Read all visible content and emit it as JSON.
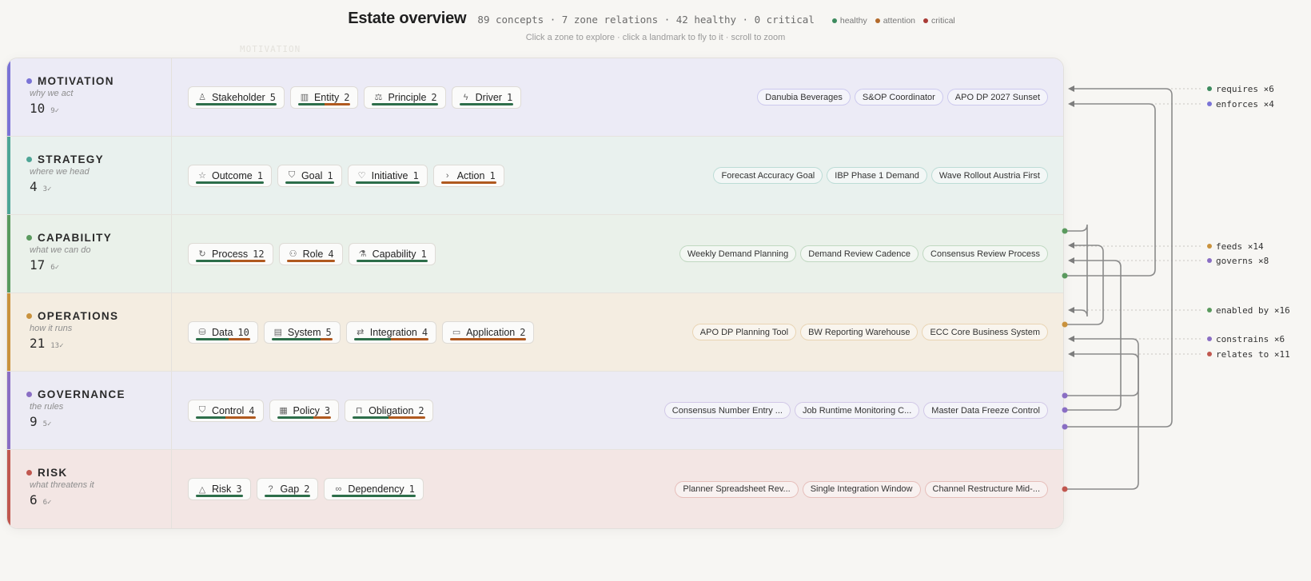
{
  "header": {
    "title": "Estate overview",
    "stats": "89 concepts · 7 zone relations · 42 healthy · 0 critical",
    "subtitle": "Click a zone to explore · click a landmark to fly to it · scroll to zoom",
    "legend": [
      {
        "label": "healthy",
        "color": "#3d8b5e"
      },
      {
        "label": "attention",
        "color": "#b36a2b"
      },
      {
        "label": "critical",
        "color": "#a93a35"
      }
    ]
  },
  "ghost_label": "MOTIVATION",
  "zones": [
    {
      "name": "MOTIVATION",
      "subtitle": "why we act",
      "count": "10",
      "healthy": "9✓",
      "accent": "#7a73d6",
      "bg": "#ecebf6",
      "chips": [
        {
          "icon": "person-icon",
          "glyph": "♙",
          "label": "Stakeholder",
          "count": "5",
          "health": [
            1,
            0,
            0
          ]
        },
        {
          "icon": "building-icon",
          "glyph": "▥",
          "label": "Entity",
          "count": "2",
          "health": [
            0.5,
            0.5,
            0
          ]
        },
        {
          "icon": "scale-icon",
          "glyph": "⚖",
          "label": "Principle",
          "count": "2",
          "health": [
            1,
            0,
            0
          ]
        },
        {
          "icon": "bolt-icon",
          "glyph": "ϟ",
          "label": "Driver",
          "count": "1",
          "health": [
            1,
            0,
            0
          ]
        }
      ],
      "landmarks": [
        {
          "label": "Danubia Beverages"
        },
        {
          "label": "S&OP Coordinator"
        },
        {
          "label": "APO DP 2027 Sunset"
        }
      ]
    },
    {
      "name": "STRATEGY",
      "subtitle": "where we head",
      "count": "4",
      "healthy": "3✓",
      "accent": "#4ea596",
      "bg": "#e9f1ee",
      "chips": [
        {
          "icon": "star-icon",
          "glyph": "☆",
          "label": "Outcome",
          "count": "1",
          "health": [
            1,
            0,
            0
          ]
        },
        {
          "icon": "shield-icon",
          "glyph": "⛉",
          "label": "Goal",
          "count": "1",
          "health": [
            1,
            0,
            0
          ]
        },
        {
          "icon": "heart-icon",
          "glyph": "♡",
          "label": "Initiative",
          "count": "1",
          "health": [
            1,
            0,
            0
          ]
        },
        {
          "icon": "chevron-right-icon",
          "glyph": "›",
          "label": "Action",
          "count": "1",
          "health": [
            0,
            1,
            0
          ]
        }
      ],
      "landmarks": [
        {
          "label": "Forecast Accuracy Goal"
        },
        {
          "label": "IBP Phase 1 Demand"
        },
        {
          "label": "Wave Rollout Austria First"
        }
      ]
    },
    {
      "name": "CAPABILITY",
      "subtitle": "what we can do",
      "count": "17",
      "healthy": "6✓",
      "accent": "#5a9a5e",
      "bg": "#eaf1ea",
      "chips": [
        {
          "icon": "cycle-icon",
          "glyph": "↻",
          "label": "Process",
          "count": "12",
          "health": [
            0.5,
            0.5,
            0
          ]
        },
        {
          "icon": "people-icon",
          "glyph": "⚇",
          "label": "Role",
          "count": "4",
          "health": [
            0,
            1,
            0
          ]
        },
        {
          "icon": "flask-icon",
          "glyph": "⚗",
          "label": "Capability",
          "count": "1",
          "health": [
            1,
            0,
            0
          ]
        }
      ],
      "landmarks": [
        {
          "label": "Weekly Demand Planning"
        },
        {
          "label": "Demand Review Cadence"
        },
        {
          "label": "Consensus Review Process"
        }
      ]
    },
    {
      "name": "OPERATIONS",
      "subtitle": "how it runs",
      "count": "21",
      "healthy": "13✓",
      "accent": "#c9923d",
      "bg": "#f4ede1",
      "chips": [
        {
          "icon": "database-icon",
          "glyph": "⛁",
          "label": "Data",
          "count": "10",
          "health": [
            0.6,
            0.4,
            0
          ]
        },
        {
          "icon": "server-icon",
          "glyph": "▤",
          "label": "System",
          "count": "5",
          "health": [
            0.8,
            0.2,
            0
          ]
        },
        {
          "icon": "swap-icon",
          "glyph": "⇄",
          "label": "Integration",
          "count": "4",
          "health": [
            0.5,
            0.5,
            0
          ]
        },
        {
          "icon": "monitor-icon",
          "glyph": "▭",
          "label": "Application",
          "count": "2",
          "health": [
            0,
            1,
            0
          ]
        }
      ],
      "landmarks": [
        {
          "label": "APO DP Planning Tool"
        },
        {
          "label": "BW Reporting Warehouse"
        },
        {
          "label": "ECC Core Business System"
        }
      ]
    },
    {
      "name": "GOVERNANCE",
      "subtitle": "the rules",
      "count": "9",
      "healthy": "5✓",
      "accent": "#8a6ec4",
      "bg": "#ecebf4",
      "chips": [
        {
          "icon": "shield-check-icon",
          "glyph": "⛉",
          "label": "Control",
          "count": "4",
          "health": [
            0.5,
            0.5,
            0
          ]
        },
        {
          "icon": "document-icon",
          "glyph": "▦",
          "label": "Policy",
          "count": "3",
          "health": [
            0.67,
            0.33,
            0
          ]
        },
        {
          "icon": "lock-icon",
          "glyph": "⊓",
          "label": "Obligation",
          "count": "2",
          "health": [
            0.5,
            0.5,
            0
          ]
        }
      ],
      "landmarks": [
        {
          "label": "Consensus Number Entry ..."
        },
        {
          "label": "Job Runtime Monitoring C..."
        },
        {
          "label": "Master Data Freeze Control"
        }
      ]
    },
    {
      "name": "RISK",
      "subtitle": "what threatens it",
      "count": "6",
      "healthy": "6✓",
      "accent": "#c0574f",
      "bg": "#f3e6e4",
      "chips": [
        {
          "icon": "warning-icon",
          "glyph": "△",
          "label": "Risk",
          "count": "3",
          "health": [
            1,
            0,
            0
          ]
        },
        {
          "icon": "question-icon",
          "glyph": "?",
          "label": "Gap",
          "count": "2",
          "health": [
            1,
            0,
            0
          ]
        },
        {
          "icon": "link-icon",
          "glyph": "∞",
          "label": "Dependency",
          "count": "1",
          "health": [
            1,
            0,
            0
          ]
        }
      ],
      "landmarks": [
        {
          "label": "Planner Spreadsheet Rev..."
        },
        {
          "label": "Single Integration Window"
        },
        {
          "label": "Channel Restructure Mid-..."
        }
      ]
    }
  ],
  "relations": [
    {
      "label": "requires ×6",
      "color": "#3d8b5e",
      "from": "GOVERNANCE",
      "to": "MOTIVATION"
    },
    {
      "label": "enforces ×4",
      "color": "#7a73d6",
      "from": "CAPABILITY",
      "to": "MOTIVATION"
    },
    {
      "label": "feeds ×14",
      "color": "#c9923d",
      "from": "OPERATIONS",
      "to": "CAPABILITY"
    },
    {
      "label": "governs ×8",
      "color": "#8a6ec4",
      "from": "GOVERNANCE",
      "to": "CAPABILITY"
    },
    {
      "label": "enabled by ×16",
      "color": "#5a9a5e",
      "from": "CAPABILITY",
      "to": "OPERATIONS"
    },
    {
      "label": "constrains ×6",
      "color": "#8a6ec4",
      "from": "GOVERNANCE",
      "to": "OPERATIONS"
    },
    {
      "label": "relates to ×11",
      "color": "#c0574f",
      "from": "RISK",
      "to": "OPERATIONS"
    }
  ]
}
